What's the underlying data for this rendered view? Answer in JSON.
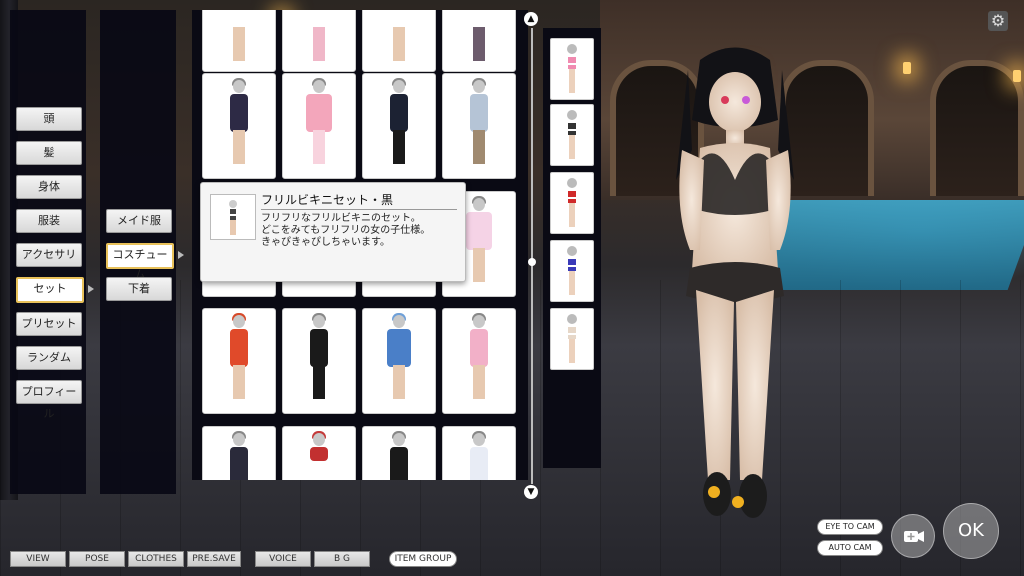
{
  "main_menu": [
    {
      "label": "頭",
      "selected": false
    },
    {
      "label": "髪",
      "selected": false
    },
    {
      "label": "身体",
      "selected": false
    },
    {
      "label": "服装",
      "selected": false
    },
    {
      "label": "アクセサリ",
      "selected": false
    },
    {
      "label": "セット",
      "selected": true
    },
    {
      "label": "プリセット",
      "selected": false
    },
    {
      "label": "ランダム",
      "selected": false
    },
    {
      "label": "プロフィール",
      "selected": false
    }
  ],
  "sub_menu": [
    {
      "label": "メイド服",
      "selected": false
    },
    {
      "label": "コスチューム",
      "selected": true
    },
    {
      "label": "下着",
      "selected": false
    }
  ],
  "tooltip": {
    "title": "フリルビキニセット・黒",
    "description": "フリフリなフリルビキニのセット。\nどこをみてもフリフリの女の子仕様。\nきゃぴきゃぴしちゃいます。"
  },
  "bottom_bar": {
    "view": "VIEW",
    "pose": "POSE",
    "clothes": "CLOTHES",
    "pre_save": "PRE.SAVE",
    "voice": "VOICE",
    "bg": "B G",
    "item_group": "ITEM GROUP"
  },
  "camera": {
    "eye_to_cam": "EYE TO CAM",
    "auto_cam": "AUTO CAM"
  },
  "ok_label": "OK",
  "icons": {
    "settings": "gear-icon",
    "camera": "video-camera-plus-icon",
    "scroll_up": "arrow-up-circle-icon",
    "scroll_down": "arrow-down-circle-icon"
  }
}
